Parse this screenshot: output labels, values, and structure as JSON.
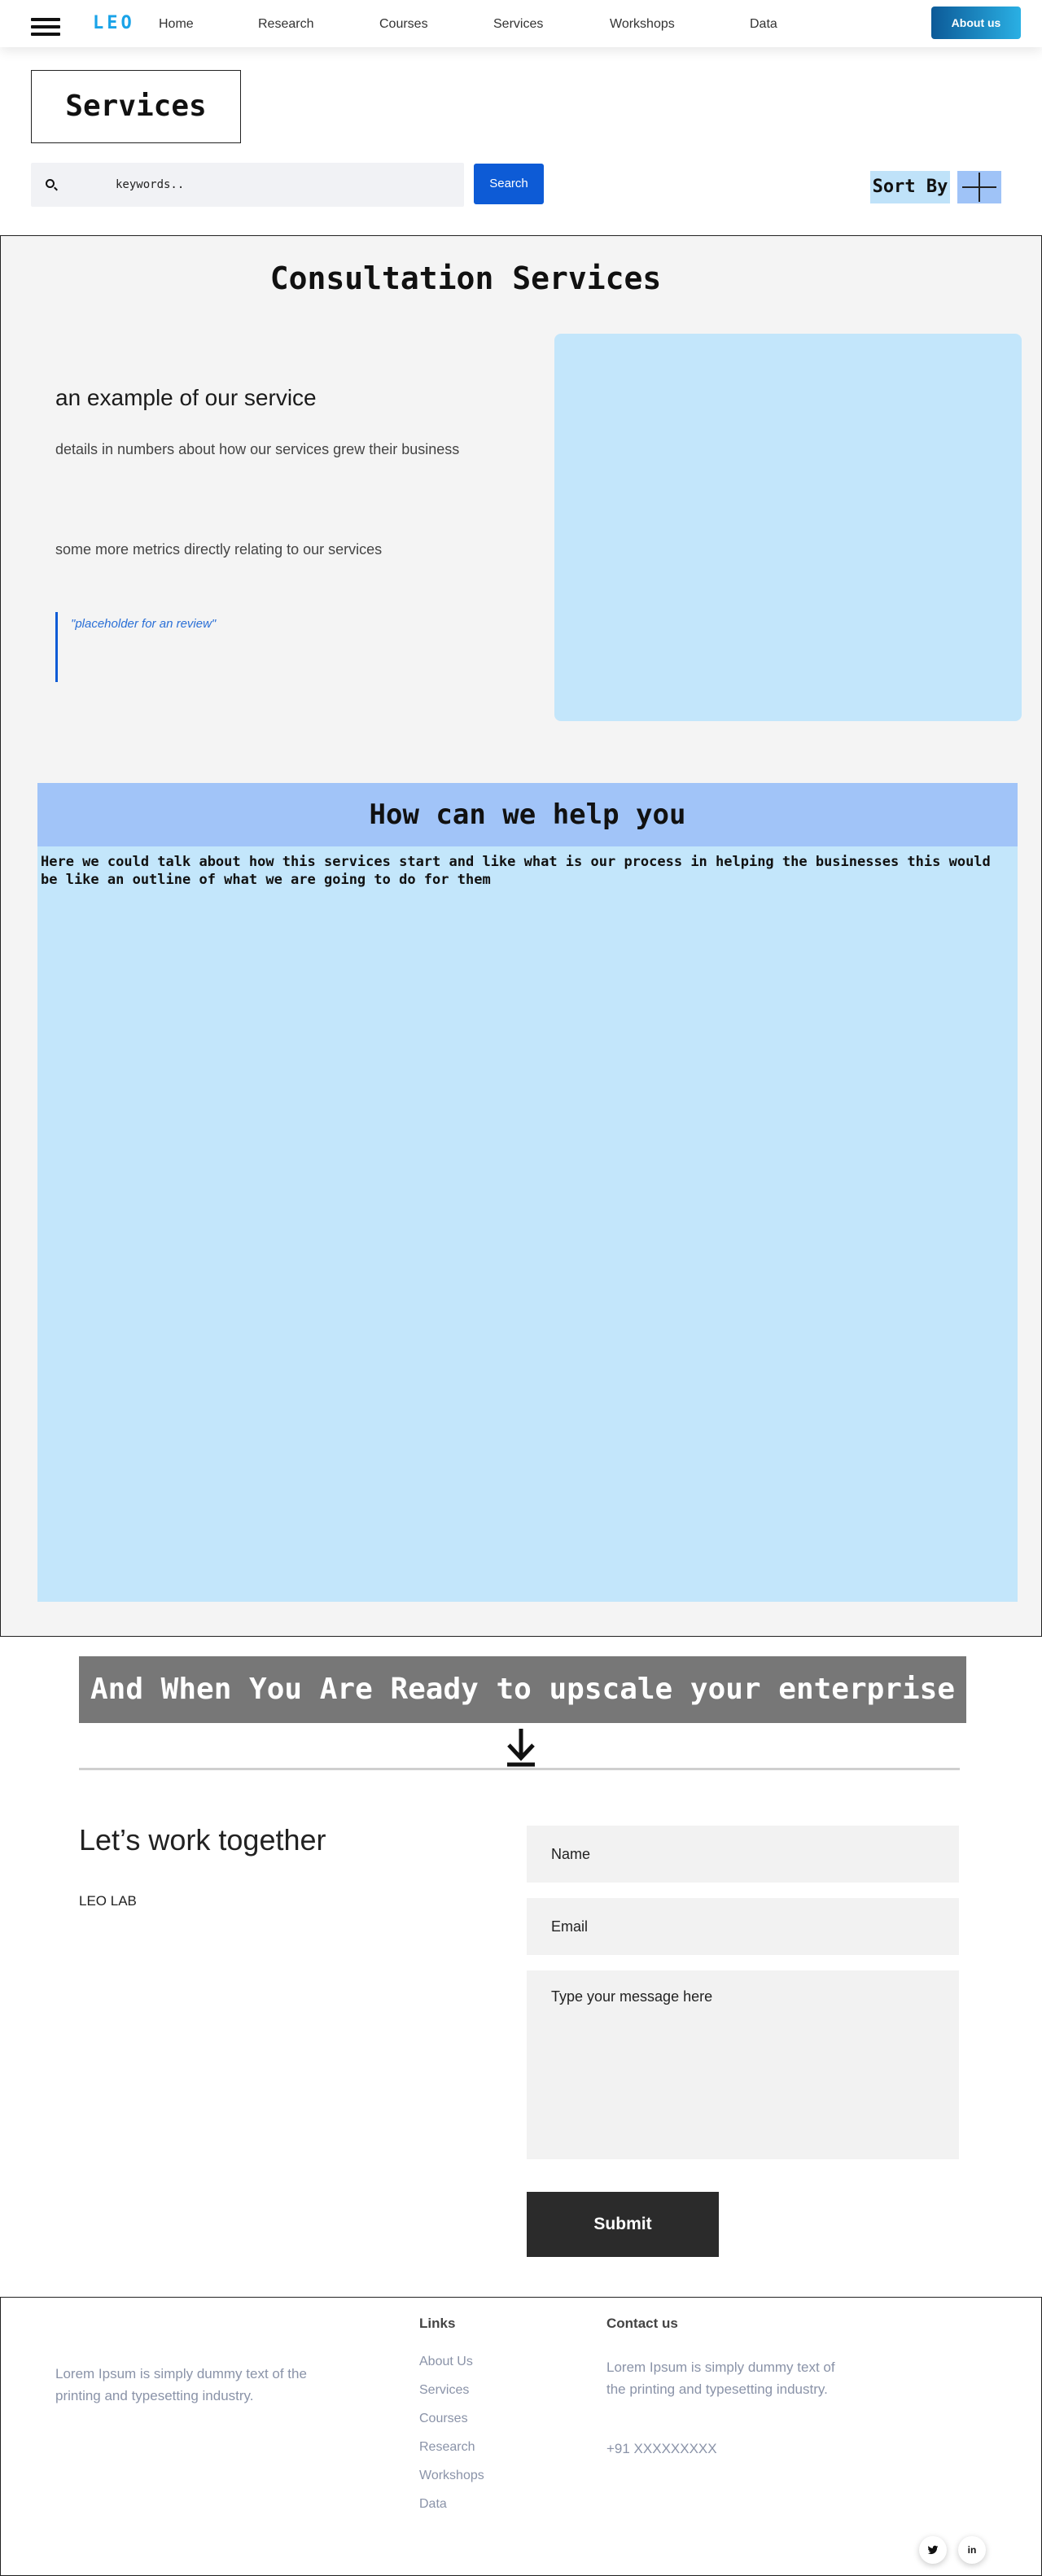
{
  "nav": {
    "menu_icon": "hamburger-icon",
    "logo": "LEO",
    "links": [
      "Home",
      "Research",
      "Courses",
      "Services",
      "Workshops",
      "Data"
    ],
    "about_button": "About us"
  },
  "page": {
    "title": "Services"
  },
  "search": {
    "icon": "search-icon",
    "placeholder": "keywords..",
    "button": "Search"
  },
  "sort": {
    "label": "Sort By",
    "toggle_icon": "plus-icon"
  },
  "consultation": {
    "title": "Consultation Services",
    "example_title": "an example of our service",
    "detail_1": "details in numbers about how our services grew their business",
    "detail_2": "some more metrics directly relating to our services",
    "review": "\"placeholder for an review\""
  },
  "help": {
    "title": "How can we help you",
    "text": "Here we could talk about how this services start and like what is our process in helping the businesses this would be like an outline of what we are going to do for them"
  },
  "upscale": {
    "banner": "And When You Are Ready to upscale your enterprise",
    "arrow_icon": "arrow-down-icon"
  },
  "contact": {
    "title": "Let’s work together",
    "org": "LEO LAB",
    "name_placeholder": "Name",
    "email_placeholder": "Email",
    "message_placeholder": "Type your message here",
    "submit": "Submit"
  },
  "footer": {
    "about_text": "Lorem Ipsum is simply dummy text of the printing and typesetting industry.",
    "links_title": "Links",
    "links": [
      "About Us",
      "Services",
      "Courses",
      "Research",
      "Workshops",
      "Data"
    ],
    "contact_title": "Contact us",
    "contact_text": "Lorem Ipsum is simply dummy text of the printing and typesetting industry.",
    "phone": "+91 XXXXXXXXX",
    "social": [
      {
        "icon": "twitter-icon",
        "glyph": "🐦"
      },
      {
        "icon": "linkedin-icon",
        "glyph": "in"
      }
    ]
  },
  "colors": {
    "brand": "#1aa3e8",
    "primary_button": "#0d5bd6",
    "light_blue_panel": "#c3e6fb",
    "help_header": "#a1c4f8",
    "banner_gray": "#777777",
    "submit_dark": "#2b2b2b"
  }
}
